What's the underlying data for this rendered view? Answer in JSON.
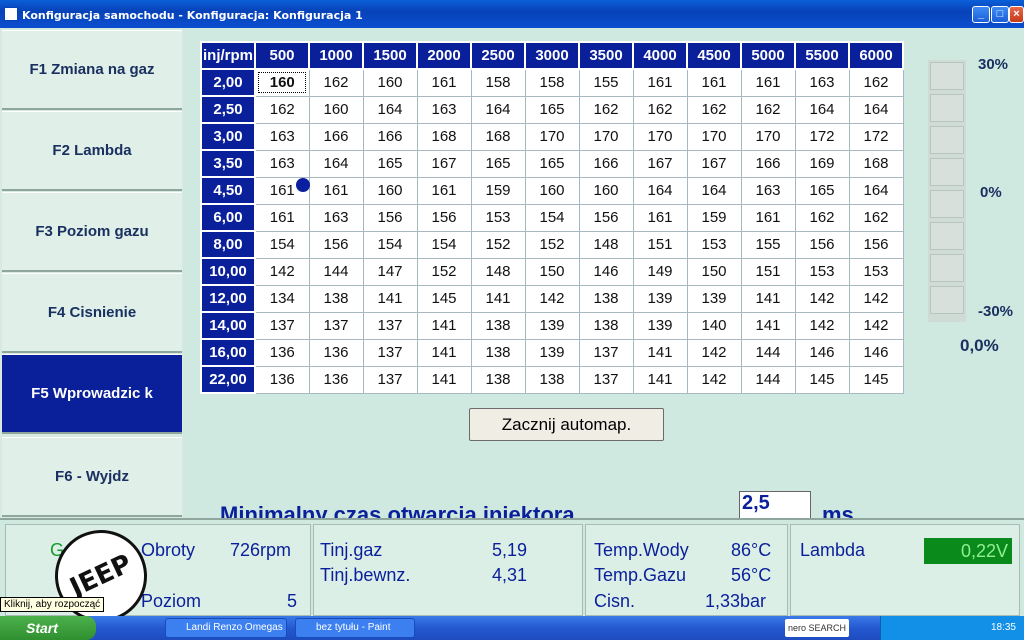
{
  "window": {
    "title": "Konfiguracja samochodu - Konfiguracja: Konfiguracja 1"
  },
  "sidebar": {
    "items": [
      {
        "label": "F1 Zmiana na gaz"
      },
      {
        "label": "F2 Lambda"
      },
      {
        "label": "F3 Poziom gazu"
      },
      {
        "label": "F4 Cisnienie"
      },
      {
        "label": "F5 Wprowadzic k"
      },
      {
        "label": "F6 - Wyjdz"
      }
    ],
    "active_index": 4
  },
  "table": {
    "corner": "inj/rpm",
    "columns": [
      "500",
      "1000",
      "1500",
      "2000",
      "2500",
      "3000",
      "3500",
      "4000",
      "4500",
      "5000",
      "5500",
      "6000"
    ],
    "rows": [
      {
        "label": "2,00",
        "values": [
          "160",
          "162",
          "160",
          "161",
          "158",
          "158",
          "155",
          "161",
          "161",
          "161",
          "163",
          "162"
        ]
      },
      {
        "label": "2,50",
        "values": [
          "162",
          "160",
          "164",
          "163",
          "164",
          "165",
          "162",
          "162",
          "162",
          "162",
          "164",
          "164"
        ]
      },
      {
        "label": "3,00",
        "values": [
          "163",
          "166",
          "166",
          "168",
          "168",
          "170",
          "170",
          "170",
          "170",
          "170",
          "172",
          "172"
        ]
      },
      {
        "label": "3,50",
        "values": [
          "163",
          "164",
          "165",
          "167",
          "165",
          "165",
          "166",
          "167",
          "167",
          "166",
          "169",
          "168"
        ]
      },
      {
        "label": "4,50",
        "values": [
          "161",
          "161",
          "160",
          "161",
          "159",
          "160",
          "160",
          "164",
          "164",
          "163",
          "165",
          "164"
        ]
      },
      {
        "label": "6,00",
        "values": [
          "161",
          "163",
          "156",
          "156",
          "153",
          "154",
          "156",
          "161",
          "159",
          "161",
          "162",
          "162"
        ]
      },
      {
        "label": "8,00",
        "values": [
          "154",
          "156",
          "154",
          "154",
          "152",
          "152",
          "148",
          "151",
          "153",
          "155",
          "156",
          "156"
        ]
      },
      {
        "label": "10,00",
        "values": [
          "142",
          "144",
          "147",
          "152",
          "148",
          "150",
          "146",
          "149",
          "150",
          "151",
          "153",
          "153"
        ]
      },
      {
        "label": "12,00",
        "values": [
          "134",
          "138",
          "141",
          "145",
          "141",
          "142",
          "138",
          "139",
          "139",
          "141",
          "142",
          "142"
        ]
      },
      {
        "label": "14,00",
        "values": [
          "137",
          "137",
          "137",
          "141",
          "138",
          "139",
          "138",
          "139",
          "140",
          "141",
          "142",
          "142"
        ]
      },
      {
        "label": "16,00",
        "values": [
          "136",
          "136",
          "137",
          "141",
          "138",
          "139",
          "137",
          "141",
          "142",
          "144",
          "146",
          "146"
        ]
      },
      {
        "label": "22,00",
        "values": [
          "136",
          "136",
          "137",
          "141",
          "138",
          "138",
          "137",
          "141",
          "142",
          "144",
          "145",
          "145"
        ]
      }
    ]
  },
  "correction_bar": {
    "top_label": "30%",
    "mid_label": "0%",
    "bottom_label": "-30%",
    "value": "0,0%"
  },
  "auto_button": {
    "label": "Zacznij automap."
  },
  "min_injector": {
    "label": "Minimalny czas otwarcia iniektora",
    "value": "2,5",
    "unit": "ms"
  },
  "status": {
    "gaz": "Gaz",
    "obroty_label": "Obroty",
    "obroty_value": "726rpm",
    "poziom_label": "Poziom",
    "poziom_value": "5",
    "tinj_gaz_label": "Tinj.gaz",
    "tinj_gaz_value": "5,19",
    "tinj_benz_label": "Tinj.bewnz.",
    "tinj_benz_value": "4,31",
    "temp_wody_label": "Temp.Wody",
    "temp_wody_value": "86°C",
    "temp_gazu_label": "Temp.Gazu",
    "temp_gazu_value": "56°C",
    "cisn_label": "Cisn.",
    "cisn_value": "1,33bar",
    "lambda_label": "Lambda",
    "lambda_value": "0,22V"
  },
  "logo": {
    "text": "JEEP"
  },
  "tooltip": "Kliknij, aby rozpocząć",
  "taskbar": {
    "start": "Start",
    "tasks": [
      "Landi Renzo Omegas",
      "bez tytułu - Paint"
    ],
    "nero": "nero SEARCH",
    "clock": "18:35"
  }
}
